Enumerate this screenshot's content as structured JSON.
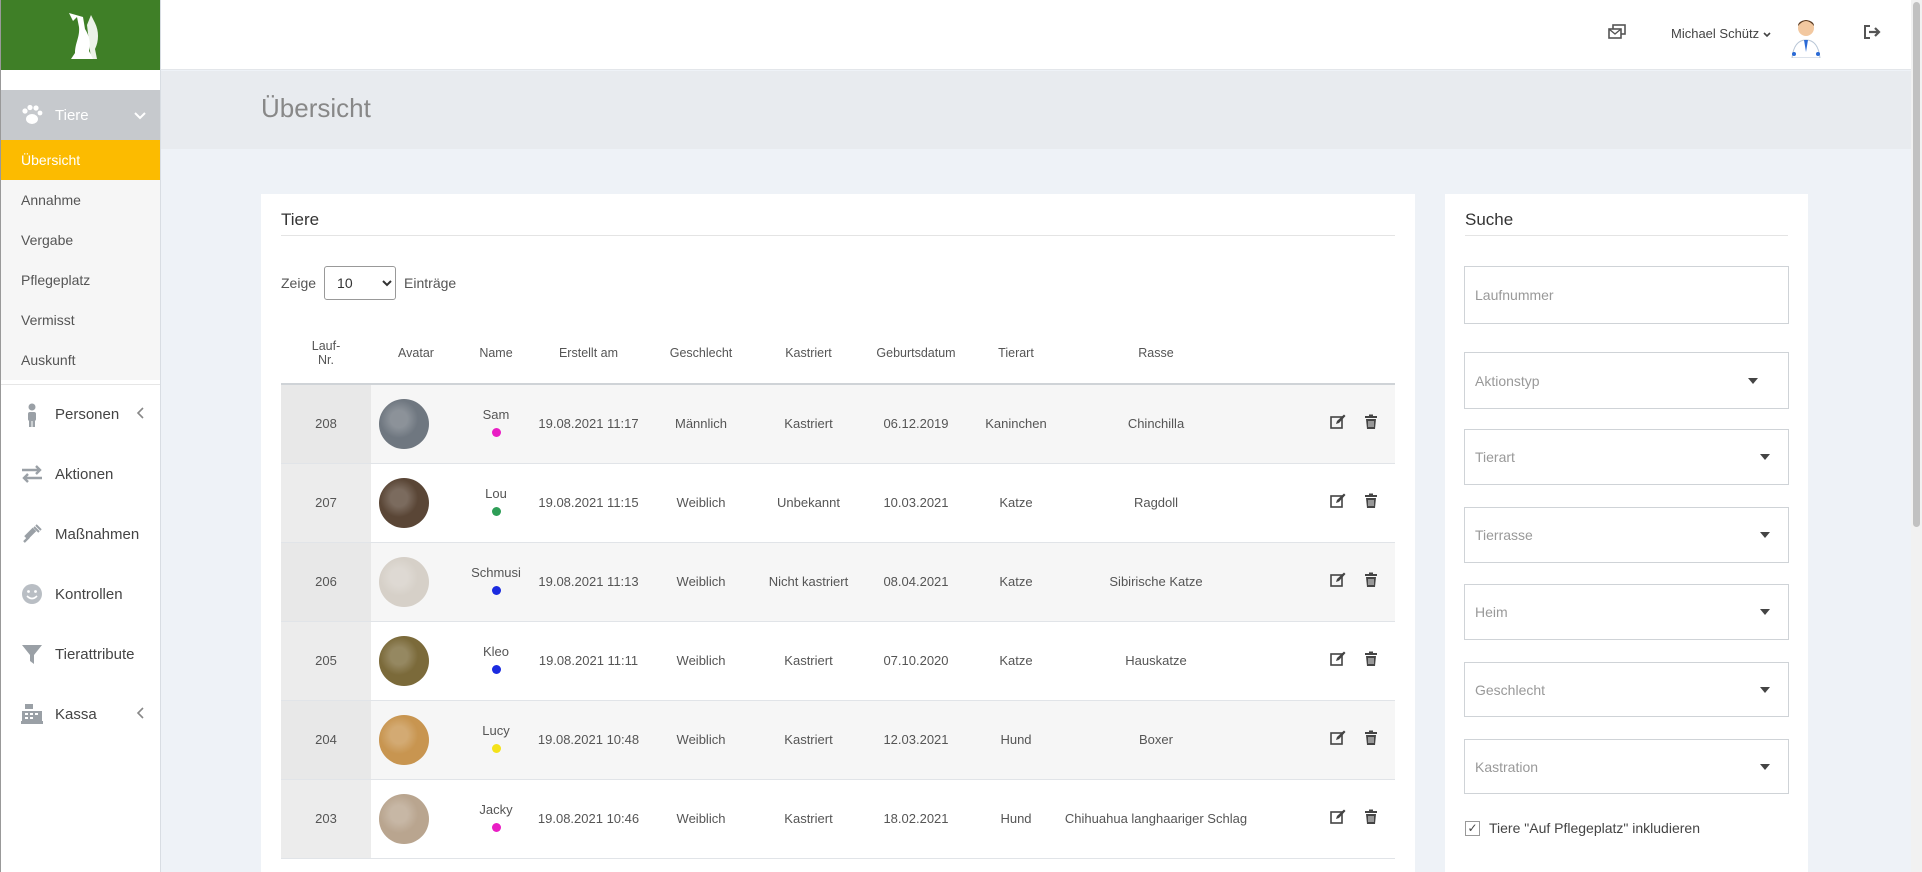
{
  "sidebar": {
    "section": {
      "label": "Tiere"
    },
    "subitems": [
      {
        "label": "Übersicht",
        "active": true
      },
      {
        "label": "Annahme"
      },
      {
        "label": "Vergabe"
      },
      {
        "label": "Pflegeplatz"
      },
      {
        "label": "Vermisst"
      },
      {
        "label": "Auskunft"
      }
    ],
    "menu": [
      {
        "label": "Personen",
        "icon": "person-icon",
        "chevron": true
      },
      {
        "label": "Aktionen",
        "icon": "arrows-exchange-icon"
      },
      {
        "label": "Maßnahmen",
        "icon": "syringe-icon"
      },
      {
        "label": "Kontrollen",
        "icon": "smiley-icon"
      },
      {
        "label": "Tierattribute",
        "icon": "filter-icon"
      },
      {
        "label": "Kassa",
        "icon": "cash-register-icon",
        "chevron": true
      }
    ]
  },
  "topbar": {
    "user_name": "Michael Schütz"
  },
  "page": {
    "title": "Übersicht"
  },
  "animals_panel": {
    "title": "Tiere",
    "show_label": "Zeige",
    "entries_label": "Einträge",
    "page_size": "10",
    "columns": [
      "Lauf-\nNr.",
      "Avatar",
      "Name",
      "Erstellt am",
      "Geschlecht",
      "Kastriert",
      "Geburtsdatum",
      "Tierart",
      "Rasse"
    ],
    "rows": [
      {
        "nr": "208",
        "name": "Sam",
        "dot": "#e91ec4",
        "created": "19.08.2021 11:17",
        "sex": "Männlich",
        "neutered": "Kastriert",
        "birth": "06.12.2019",
        "species": "Kaninchen",
        "breed": "Chinchilla",
        "avatar_color": "#6f7780"
      },
      {
        "nr": "207",
        "name": "Lou",
        "dot": "#2e9e57",
        "created": "19.08.2021 11:15",
        "sex": "Weiblich",
        "neutered": "Unbekannt",
        "birth": "10.03.2021",
        "species": "Katze",
        "breed": "Ragdoll",
        "avatar_color": "#5a4636"
      },
      {
        "nr": "206",
        "name": "Schmusi",
        "dot": "#1b2be0",
        "created": "19.08.2021 11:13",
        "sex": "Weiblich",
        "neutered": "Nicht kastriert",
        "birth": "08.04.2021",
        "species": "Katze",
        "breed": "Sibirische Katze",
        "avatar_color": "#d6d0c8"
      },
      {
        "nr": "205",
        "name": "Kleo",
        "dot": "#1b2be0",
        "created": "19.08.2021 11:11",
        "sex": "Weiblich",
        "neutered": "Kastriert",
        "birth": "07.10.2020",
        "species": "Katze",
        "breed": "Hauskatze",
        "avatar_color": "#7b6a3a"
      },
      {
        "nr": "204",
        "name": "Lucy",
        "dot": "#f4e21a",
        "created": "19.08.2021 10:48",
        "sex": "Weiblich",
        "neutered": "Kastriert",
        "birth": "12.03.2021",
        "species": "Hund",
        "breed": "Boxer",
        "avatar_color": "#c89550"
      },
      {
        "nr": "203",
        "name": "Jacky",
        "dot": "#e91ec4",
        "created": "19.08.2021 10:46",
        "sex": "Weiblich",
        "neutered": "Kastriert",
        "birth": "18.02.2021",
        "species": "Hund",
        "breed": "Chihuahua langhaariger Schlag",
        "avatar_color": "#b9a58f"
      }
    ]
  },
  "search_panel": {
    "title": "Suche",
    "laufnummer_placeholder": "Laufnummer",
    "aktionstyp_placeholder": "Aktionstyp",
    "tierart_placeholder": "Tierart",
    "tierrasse_placeholder": "Tierrasse",
    "heim_placeholder": "Heim",
    "geschlecht_placeholder": "Geschlecht",
    "kastration_placeholder": "Kastration",
    "include_label": "Tiere \"Auf Pflegeplatz\" inkludieren",
    "include_checked": true
  },
  "colors": {
    "brand_green": "#3f7f27",
    "active_yellow": "#fcbb00"
  }
}
